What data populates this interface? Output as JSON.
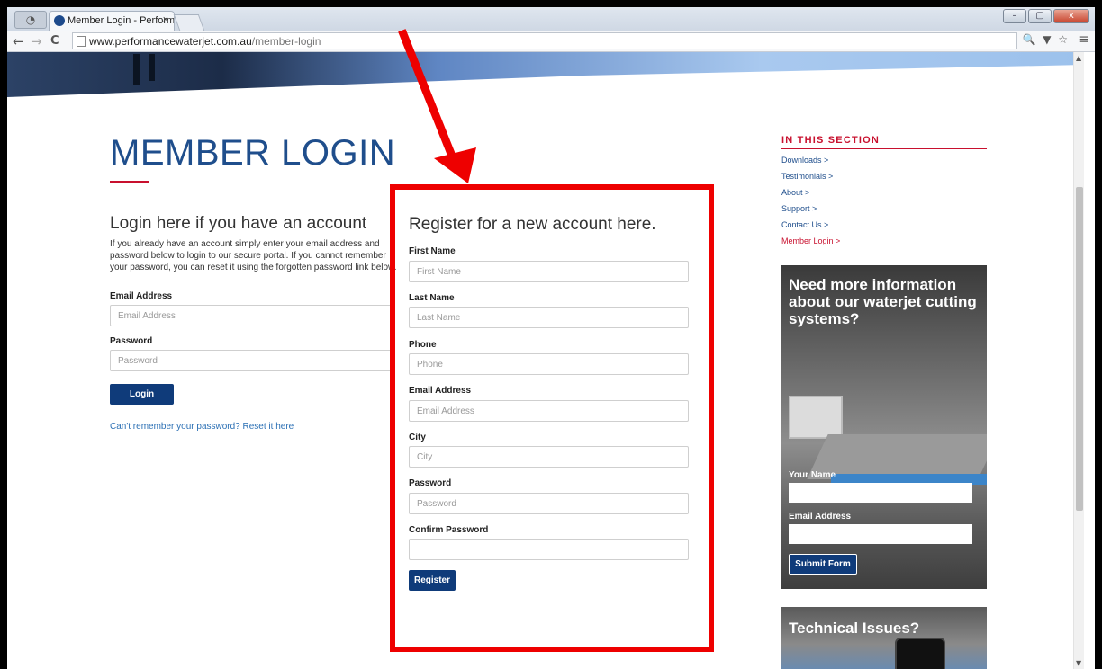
{
  "browser": {
    "tab_title": "Member Login - Performa",
    "tab_close": "×",
    "url_domain": "www.performancewaterjet.com.au",
    "url_path": "/member-login",
    "back_glyph": "←",
    "forward_glyph": "→",
    "reload_glyph": "C",
    "menu_glyph": "≡",
    "right_icons": "🔍 ▼ ☆",
    "window_minimize": "–",
    "window_maximize": "▢",
    "window_close": "x"
  },
  "page": {
    "title": "MEMBER LOGIN"
  },
  "login": {
    "heading": "Login here if you have an account",
    "description": "If you already have an account simply enter your email address and password below to login to our secure portal. If you cannot remember your password, you can reset it using the forgotten password link below.",
    "email_label": "Email Address",
    "email_placeholder": "Email Address",
    "password_label": "Password",
    "password_placeholder": "Password",
    "submit_label": "Login",
    "forgot_link": "Can't remember your password? Reset it here"
  },
  "register": {
    "heading": "Register for a new account here.",
    "first_name_label": "First Name",
    "first_name_placeholder": "First Name",
    "last_name_label": "Last Name",
    "last_name_placeholder": "Last Name",
    "phone_label": "Phone",
    "phone_placeholder": "Phone",
    "email_label": "Email Address",
    "email_placeholder": "Email Address",
    "city_label": "City",
    "city_placeholder": "City",
    "password_label": "Password",
    "password_placeholder": "Password",
    "confirm_label": "Confirm Password",
    "submit_label": "Register"
  },
  "sidebar": {
    "heading": "IN THIS SECTION",
    "links": [
      "Downloads  >",
      "Testimonials  >",
      "About  >",
      "Support  >",
      "Contact Us  >",
      "Member Login  >"
    ],
    "promo": {
      "text": "Need more information about our waterjet cutting systems?",
      "name_label": "Your Name",
      "email_label": "Email Address",
      "submit_label": "Submit Form"
    },
    "promo2": {
      "text": "Technical Issues?"
    }
  },
  "colors": {
    "brand_blue": "#0f3b7a",
    "accent_red": "#c8102e",
    "highlight_red": "#ee0000"
  }
}
